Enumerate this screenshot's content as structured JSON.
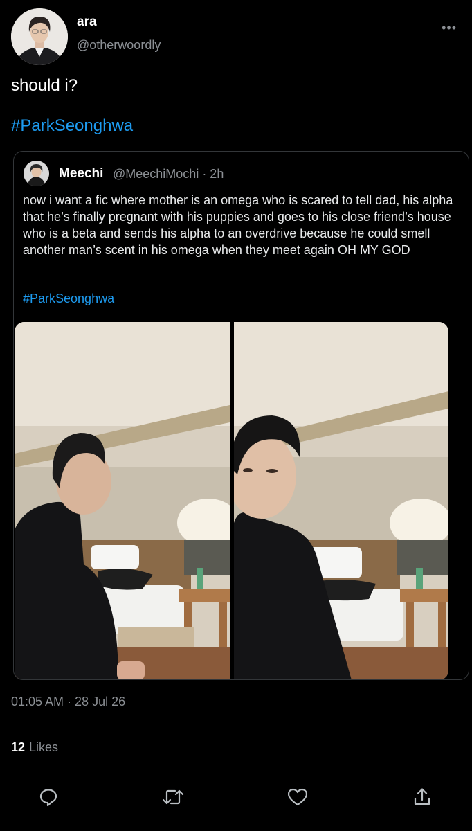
{
  "author": {
    "display_name": "ara",
    "handle": "@otherwoordly",
    "avatar_icon": "profile-photo"
  },
  "more_icon": "more-dots-icon",
  "more_glyph": "•••",
  "tweet": {
    "text": "should i?",
    "hashtag": "#ParkSeonghwa"
  },
  "quote": {
    "display_name": "Meechi",
    "handle_time": "@MeechiMochi · 2h",
    "text": "now i want a fic where mother is an omega who is scared to tell dad, his alpha that he’s finally pregnant with his puppies and goes to his close friend’s house who is a beta and sends his alpha to an overdrive because he could smell another man’s scent in his omega when they meet again OH MY GOD",
    "hashtag": "#ParkSeonghwa",
    "media_count": 2
  },
  "timestamp": "01:05 AM · 28 Jul 26",
  "stats": {
    "likes_count": "12",
    "likes_label": "Likes"
  },
  "actions": [
    {
      "icon": "reply-icon"
    },
    {
      "icon": "retweet-icon"
    },
    {
      "icon": "like-heart-icon"
    },
    {
      "icon": "share-icon"
    }
  ],
  "colors": {
    "background": "#000000",
    "text": "#ffffff",
    "secondary": "#8b8f94",
    "link": "#1d9bf0",
    "divider": "#2f3336"
  }
}
